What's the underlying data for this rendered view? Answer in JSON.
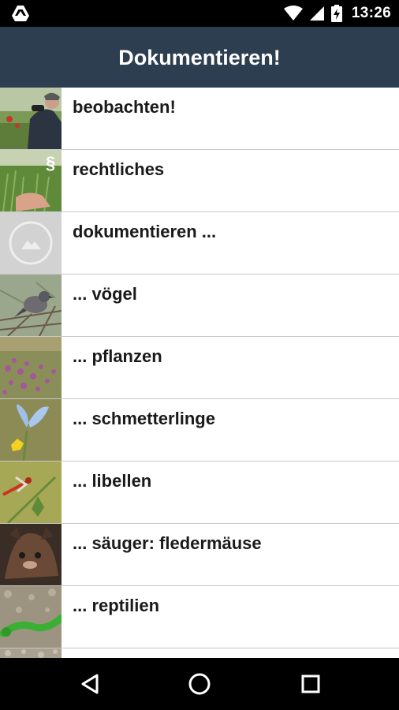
{
  "status": {
    "time": "13:26",
    "left_icon": "drive-upload-icon",
    "icons": [
      "wifi-icon",
      "cell-signal-icon",
      "battery-charging-icon"
    ]
  },
  "app_bar": {
    "title": "Dokumentieren!"
  },
  "items": [
    {
      "label": "beobachten!",
      "thumb": "birdwatcher-photo"
    },
    {
      "label": "rechtliches",
      "thumb": "paragraph-meadow-photo"
    },
    {
      "label": "dokumentieren ...",
      "thumb": "placeholder-image-icon"
    },
    {
      "label": "... vögel",
      "thumb": "bird-photo"
    },
    {
      "label": "... pflanzen",
      "thumb": "heather-flowers-photo"
    },
    {
      "label": "... schmetterlinge",
      "thumb": "blue-butterfly-photo"
    },
    {
      "label": "... libellen",
      "thumb": "red-dragonfly-photo"
    },
    {
      "label": "... säuger: fledermäuse",
      "thumb": "bat-photo"
    },
    {
      "label": "... reptilien",
      "thumb": "green-lizard-photo"
    },
    {
      "label": "",
      "thumb": "partial-photo"
    }
  ],
  "nav": {
    "back": "back-triangle-icon",
    "home": "home-circle-icon",
    "recent": "recent-apps-square-icon"
  },
  "colors": {
    "app_bar": "#2d3e50",
    "status_bar": "#000000",
    "nav_bar": "#000000",
    "divider": "#c8c8c8"
  }
}
